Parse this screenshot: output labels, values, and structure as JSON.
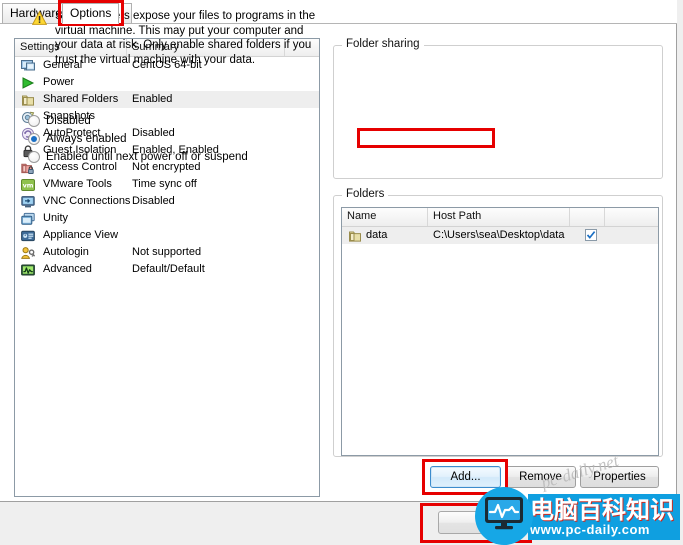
{
  "window": {
    "tabs": [
      {
        "label": "Hardware",
        "active": false
      },
      {
        "label": "Options",
        "active": true
      }
    ]
  },
  "settings_list": {
    "columns": [
      "Settings",
      "Summary",
      ""
    ],
    "rows": [
      {
        "icon": "monitor-icon",
        "label": "General",
        "summary": "CentOS 64-bit",
        "selected": false
      },
      {
        "icon": "play-icon",
        "label": "Power",
        "summary": "",
        "selected": false
      },
      {
        "icon": "folder-icon",
        "label": "Shared Folders",
        "summary": "Enabled",
        "selected": true
      },
      {
        "icon": "camera-icon",
        "label": "Snapshots",
        "summary": "",
        "selected": false
      },
      {
        "icon": "refresh-icon",
        "label": "AutoProtect",
        "summary": "Disabled",
        "selected": false
      },
      {
        "icon": "lock-icon",
        "label": "Guest Isolation",
        "summary": "Enabled, Enabled",
        "selected": false
      },
      {
        "icon": "padlock-folder-icon",
        "label": "Access Control",
        "summary": "Not encrypted",
        "selected": false
      },
      {
        "icon": "vm-tools-icon",
        "label": "VMware Tools",
        "summary": "Time sync off",
        "selected": false
      },
      {
        "icon": "vnc-icon",
        "label": "VNC Connections",
        "summary": "Disabled",
        "selected": false
      },
      {
        "icon": "windows-icon",
        "label": "Unity",
        "summary": "",
        "selected": false
      },
      {
        "icon": "appliance-icon",
        "label": "Appliance View",
        "summary": "",
        "selected": false
      },
      {
        "icon": "user-key-icon",
        "label": "Autologin",
        "summary": "Not supported",
        "selected": false
      },
      {
        "icon": "chart-icon",
        "label": "Advanced",
        "summary": "Default/Default",
        "selected": false
      }
    ]
  },
  "folder_sharing": {
    "title": "Folder sharing",
    "warning_icon": "warning-icon",
    "warning_text": "Shared folders expose your files to programs in the virtual machine. This may put your computer and your data at risk. Only enable shared folders if you trust the virtual machine with your data.",
    "options": [
      {
        "label": "Disabled",
        "selected": false
      },
      {
        "label": "Always enabled",
        "selected": true
      },
      {
        "label": "Enabled until next power off or suspend",
        "selected": false
      }
    ]
  },
  "folders": {
    "title": "Folders",
    "columns": [
      "Name",
      "Host Path",
      "",
      ""
    ],
    "rows": [
      {
        "icon": "folder-icon",
        "name": "data",
        "host_path": "C:\\Users\\sea\\Desktop\\data",
        "enabled": true
      }
    ]
  },
  "buttons": {
    "add": "Add...",
    "remove": "Remove",
    "properties": "Properties",
    "bottom": ""
  },
  "watermark": {
    "brand_cn": "电脑百科知识",
    "url": "www.pc-daily.com",
    "faint": "pc-daily.net",
    "logo_icon": "monitor-pulse-icon"
  },
  "colors": {
    "annotation_red": "#e60000",
    "accent_blue": "#1a6fc4",
    "watermark_blue": "#0f9fe0"
  }
}
